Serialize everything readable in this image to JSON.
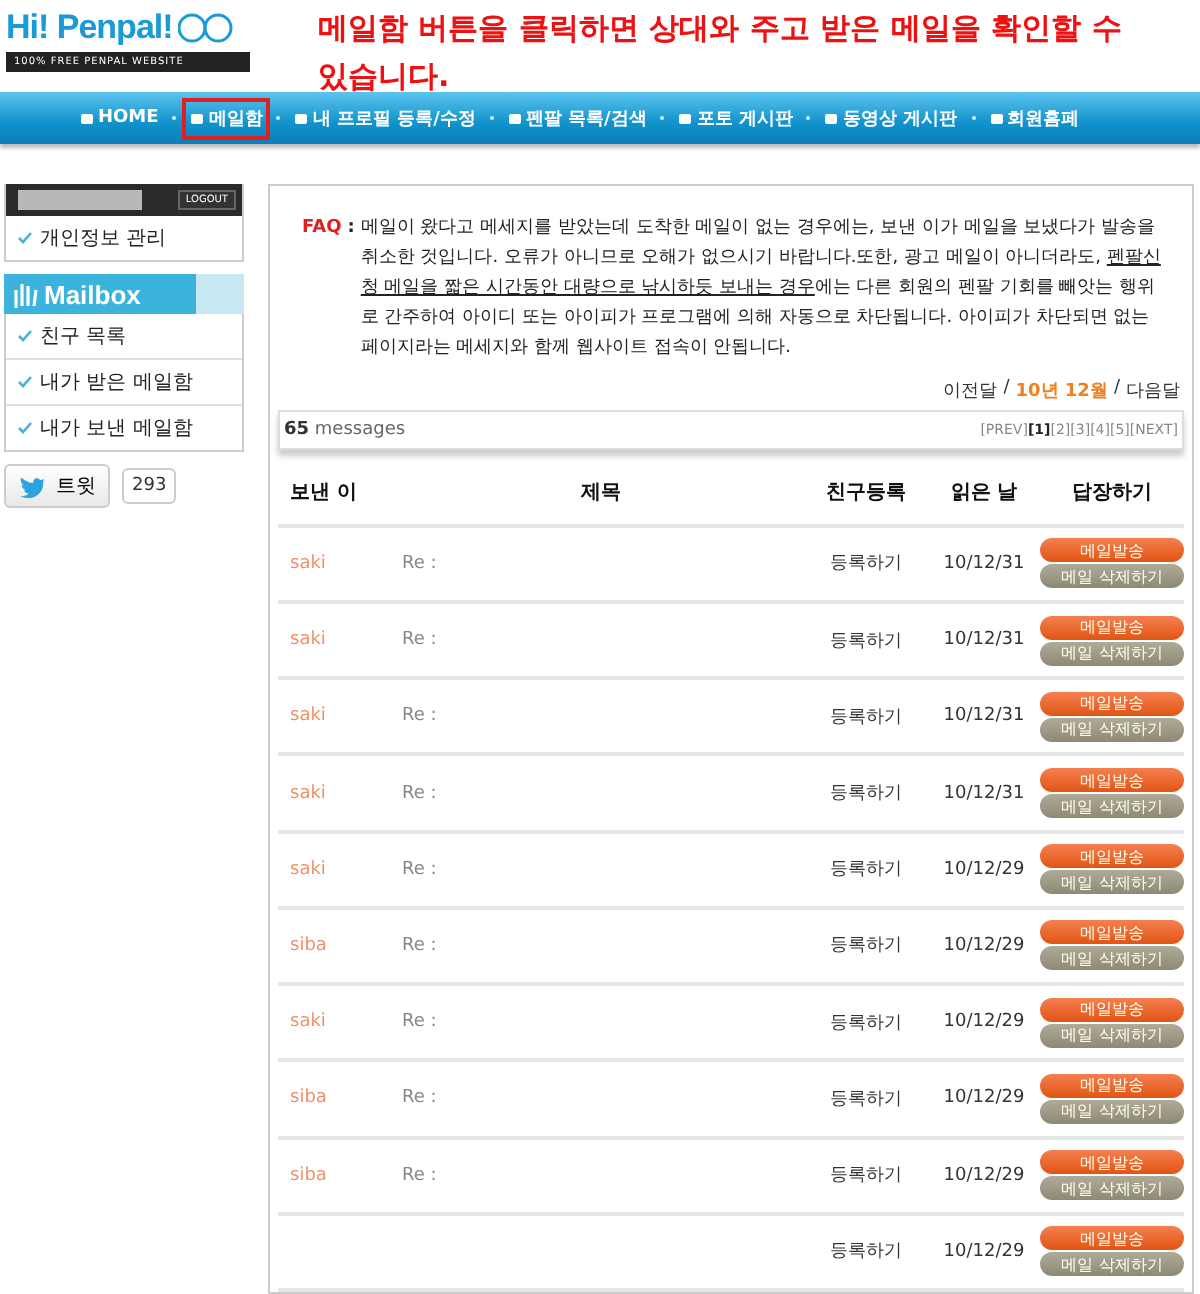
{
  "logo": {
    "title": "Hi! Penpal!",
    "tagline": "100% FREE PENPAL WEBSITE"
  },
  "annotation": "메일함 버튼을 클릭하면 상대와 주고 받은 메일을 확인할 수 있습니다.",
  "nav": [
    {
      "label": "HOME",
      "highlighted": false
    },
    {
      "label": "메일함",
      "highlighted": true
    },
    {
      "label": "내 프로필 등록/수정",
      "highlighted": false
    },
    {
      "label": "펜팔 목록/검색",
      "highlighted": false
    },
    {
      "label": "포토 게시판",
      "highlighted": false
    },
    {
      "label": "동영상 게시판",
      "highlighted": false
    },
    {
      "label": "회원홈페",
      "highlighted": false
    }
  ],
  "sidebar": {
    "logout": "LOGOUT",
    "account_items": [
      "개인정보 관리"
    ],
    "mailbox_title": "Mailbox",
    "mailbox_items": [
      "친구 목록",
      "내가 받은 메일함",
      "내가 보낸 메일함"
    ],
    "tweet": "트윗",
    "tweet_count": "293"
  },
  "faq": {
    "label": "FAQ",
    "colon": ":",
    "segments": [
      {
        "text": "메일이 왔다고 메세지를 받았는데 도착한 메일이 없는 경우에는, 보낸 이가 메일을 보냈다가 발송을 취소한 것입니다. 오류가 아니므로 오해가 없으시기 바랍니다.또한, 광고 메일이 아니더라도, ",
        "underlined": false
      },
      {
        "text": "펜팔신청 메일을 짧은 시간동안 대량으로 낚시하듯 보내는 경우",
        "underlined": true
      },
      {
        "text": "에는 다른 회원의 펜팔 기회를 빼앗는 행위로 간주하여 아이디 또는 아이피가 프로그램에 의해 자동으로 차단됩니다. 아이피가 차단되면 없는 페이지라는 메세지와 함께 웹사이트 접속이 안됩니다.",
        "underlined": false
      }
    ]
  },
  "month_nav": {
    "prev": "이전달",
    "separator_1": "/",
    "current": "10년 12월",
    "separator_2": "/",
    "next": "다음달"
  },
  "count": {
    "number": "65",
    "label": "messages"
  },
  "pagination": [
    {
      "label": "[PREV]",
      "selected": false
    },
    {
      "label": "[1]",
      "selected": true
    },
    {
      "label": "[2]",
      "selected": false
    },
    {
      "label": "[3]",
      "selected": false
    },
    {
      "label": "[4]",
      "selected": false
    },
    {
      "label": "[5]",
      "selected": false
    },
    {
      "label": "[NEXT]",
      "selected": false
    }
  ],
  "table": {
    "columns": [
      "보낸 이",
      "제목",
      "친구등록",
      "읽은 날",
      "답장하기"
    ],
    "rows": [
      {
        "sender": "saki",
        "subject": "Re :",
        "friend": "등록하기",
        "date": "10/12/31",
        "reply": "메일발송",
        "delete": "메일 삭제하기"
      },
      {
        "sender": "saki",
        "subject": "Re :",
        "friend": "등록하기",
        "date": "10/12/31",
        "reply": "메일발송",
        "delete": "메일 삭제하기"
      },
      {
        "sender": "saki",
        "subject": "Re :",
        "friend": "등록하기",
        "date": "10/12/31",
        "reply": "메일발송",
        "delete": "메일 삭제하기"
      },
      {
        "sender": "saki",
        "subject": "Re :",
        "friend": "등록하기",
        "date": "10/12/31",
        "reply": "메일발송",
        "delete": "메일 삭제하기"
      },
      {
        "sender": "saki",
        "subject": "Re :",
        "friend": "등록하기",
        "date": "10/12/29",
        "reply": "메일발송",
        "delete": "메일 삭제하기"
      },
      {
        "sender": "siba",
        "subject": "Re :",
        "friend": "등록하기",
        "date": "10/12/29",
        "reply": "메일발송",
        "delete": "메일 삭제하기"
      },
      {
        "sender": "saki",
        "subject": "Re :",
        "friend": "등록하기",
        "date": "10/12/29",
        "reply": "메일발송",
        "delete": "메일 삭제하기"
      },
      {
        "sender": "siba",
        "subject": "Re :",
        "friend": "등록하기",
        "date": "10/12/29",
        "reply": "메일발송",
        "delete": "메일 삭제하기"
      },
      {
        "sender": "siba",
        "subject": "Re :",
        "friend": "등록하기",
        "date": "10/12/29",
        "reply": "메일발송",
        "delete": "메일 삭제하기"
      },
      {
        "friend": "등록하기",
        "date": "10/12/29",
        "reply": "메일발송",
        "delete": "메일 삭제하기"
      }
    ]
  }
}
